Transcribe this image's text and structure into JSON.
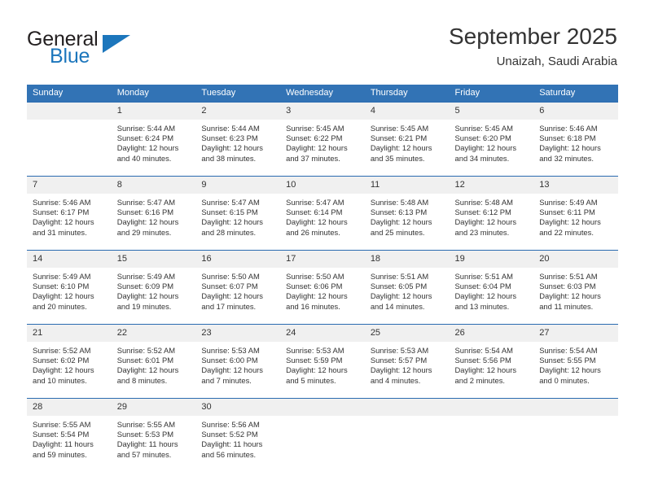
{
  "brand": {
    "word1": "General",
    "word2": "Blue",
    "triangle_icon": "triangle-icon",
    "accent_color": "#1c76bc"
  },
  "header": {
    "title": "September 2025",
    "subtitle": "Unaizah, Saudi Arabia"
  },
  "calendar": {
    "header_bg": "#3273b5",
    "daynum_bg": "#f0f0f0",
    "weekday_headers": [
      "Sunday",
      "Monday",
      "Tuesday",
      "Wednesday",
      "Thursday",
      "Friday",
      "Saturday"
    ],
    "weeks": [
      [
        {
          "day": "",
          "blank": true,
          "sunrise": "",
          "sunset": "",
          "daylight1": "",
          "daylight2": ""
        },
        {
          "day": "1",
          "sunrise": "Sunrise: 5:44 AM",
          "sunset": "Sunset: 6:24 PM",
          "daylight1": "Daylight: 12 hours",
          "daylight2": "and 40 minutes."
        },
        {
          "day": "2",
          "sunrise": "Sunrise: 5:44 AM",
          "sunset": "Sunset: 6:23 PM",
          "daylight1": "Daylight: 12 hours",
          "daylight2": "and 38 minutes."
        },
        {
          "day": "3",
          "sunrise": "Sunrise: 5:45 AM",
          "sunset": "Sunset: 6:22 PM",
          "daylight1": "Daylight: 12 hours",
          "daylight2": "and 37 minutes."
        },
        {
          "day": "4",
          "sunrise": "Sunrise: 5:45 AM",
          "sunset": "Sunset: 6:21 PM",
          "daylight1": "Daylight: 12 hours",
          "daylight2": "and 35 minutes."
        },
        {
          "day": "5",
          "sunrise": "Sunrise: 5:45 AM",
          "sunset": "Sunset: 6:20 PM",
          "daylight1": "Daylight: 12 hours",
          "daylight2": "and 34 minutes."
        },
        {
          "day": "6",
          "sunrise": "Sunrise: 5:46 AM",
          "sunset": "Sunset: 6:18 PM",
          "daylight1": "Daylight: 12 hours",
          "daylight2": "and 32 minutes."
        }
      ],
      [
        {
          "day": "7",
          "sunrise": "Sunrise: 5:46 AM",
          "sunset": "Sunset: 6:17 PM",
          "daylight1": "Daylight: 12 hours",
          "daylight2": "and 31 minutes."
        },
        {
          "day": "8",
          "sunrise": "Sunrise: 5:47 AM",
          "sunset": "Sunset: 6:16 PM",
          "daylight1": "Daylight: 12 hours",
          "daylight2": "and 29 minutes."
        },
        {
          "day": "9",
          "sunrise": "Sunrise: 5:47 AM",
          "sunset": "Sunset: 6:15 PM",
          "daylight1": "Daylight: 12 hours",
          "daylight2": "and 28 minutes."
        },
        {
          "day": "10",
          "sunrise": "Sunrise: 5:47 AM",
          "sunset": "Sunset: 6:14 PM",
          "daylight1": "Daylight: 12 hours",
          "daylight2": "and 26 minutes."
        },
        {
          "day": "11",
          "sunrise": "Sunrise: 5:48 AM",
          "sunset": "Sunset: 6:13 PM",
          "daylight1": "Daylight: 12 hours",
          "daylight2": "and 25 minutes."
        },
        {
          "day": "12",
          "sunrise": "Sunrise: 5:48 AM",
          "sunset": "Sunset: 6:12 PM",
          "daylight1": "Daylight: 12 hours",
          "daylight2": "and 23 minutes."
        },
        {
          "day": "13",
          "sunrise": "Sunrise: 5:49 AM",
          "sunset": "Sunset: 6:11 PM",
          "daylight1": "Daylight: 12 hours",
          "daylight2": "and 22 minutes."
        }
      ],
      [
        {
          "day": "14",
          "sunrise": "Sunrise: 5:49 AM",
          "sunset": "Sunset: 6:10 PM",
          "daylight1": "Daylight: 12 hours",
          "daylight2": "and 20 minutes."
        },
        {
          "day": "15",
          "sunrise": "Sunrise: 5:49 AM",
          "sunset": "Sunset: 6:09 PM",
          "daylight1": "Daylight: 12 hours",
          "daylight2": "and 19 minutes."
        },
        {
          "day": "16",
          "sunrise": "Sunrise: 5:50 AM",
          "sunset": "Sunset: 6:07 PM",
          "daylight1": "Daylight: 12 hours",
          "daylight2": "and 17 minutes."
        },
        {
          "day": "17",
          "sunrise": "Sunrise: 5:50 AM",
          "sunset": "Sunset: 6:06 PM",
          "daylight1": "Daylight: 12 hours",
          "daylight2": "and 16 minutes."
        },
        {
          "day": "18",
          "sunrise": "Sunrise: 5:51 AM",
          "sunset": "Sunset: 6:05 PM",
          "daylight1": "Daylight: 12 hours",
          "daylight2": "and 14 minutes."
        },
        {
          "day": "19",
          "sunrise": "Sunrise: 5:51 AM",
          "sunset": "Sunset: 6:04 PM",
          "daylight1": "Daylight: 12 hours",
          "daylight2": "and 13 minutes."
        },
        {
          "day": "20",
          "sunrise": "Sunrise: 5:51 AM",
          "sunset": "Sunset: 6:03 PM",
          "daylight1": "Daylight: 12 hours",
          "daylight2": "and 11 minutes."
        }
      ],
      [
        {
          "day": "21",
          "sunrise": "Sunrise: 5:52 AM",
          "sunset": "Sunset: 6:02 PM",
          "daylight1": "Daylight: 12 hours",
          "daylight2": "and 10 minutes."
        },
        {
          "day": "22",
          "sunrise": "Sunrise: 5:52 AM",
          "sunset": "Sunset: 6:01 PM",
          "daylight1": "Daylight: 12 hours",
          "daylight2": "and 8 minutes."
        },
        {
          "day": "23",
          "sunrise": "Sunrise: 5:53 AM",
          "sunset": "Sunset: 6:00 PM",
          "daylight1": "Daylight: 12 hours",
          "daylight2": "and 7 minutes."
        },
        {
          "day": "24",
          "sunrise": "Sunrise: 5:53 AM",
          "sunset": "Sunset: 5:59 PM",
          "daylight1": "Daylight: 12 hours",
          "daylight2": "and 5 minutes."
        },
        {
          "day": "25",
          "sunrise": "Sunrise: 5:53 AM",
          "sunset": "Sunset: 5:57 PM",
          "daylight1": "Daylight: 12 hours",
          "daylight2": "and 4 minutes."
        },
        {
          "day": "26",
          "sunrise": "Sunrise: 5:54 AM",
          "sunset": "Sunset: 5:56 PM",
          "daylight1": "Daylight: 12 hours",
          "daylight2": "and 2 minutes."
        },
        {
          "day": "27",
          "sunrise": "Sunrise: 5:54 AM",
          "sunset": "Sunset: 5:55 PM",
          "daylight1": "Daylight: 12 hours",
          "daylight2": "and 0 minutes."
        }
      ],
      [
        {
          "day": "28",
          "sunrise": "Sunrise: 5:55 AM",
          "sunset": "Sunset: 5:54 PM",
          "daylight1": "Daylight: 11 hours",
          "daylight2": "and 59 minutes."
        },
        {
          "day": "29",
          "sunrise": "Sunrise: 5:55 AM",
          "sunset": "Sunset: 5:53 PM",
          "daylight1": "Daylight: 11 hours",
          "daylight2": "and 57 minutes."
        },
        {
          "day": "30",
          "sunrise": "Sunrise: 5:56 AM",
          "sunset": "Sunset: 5:52 PM",
          "daylight1": "Daylight: 11 hours",
          "daylight2": "and 56 minutes."
        },
        {
          "day": "",
          "blank": true,
          "sunrise": "",
          "sunset": "",
          "daylight1": "",
          "daylight2": ""
        },
        {
          "day": "",
          "blank": true,
          "sunrise": "",
          "sunset": "",
          "daylight1": "",
          "daylight2": ""
        },
        {
          "day": "",
          "blank": true,
          "sunrise": "",
          "sunset": "",
          "daylight1": "",
          "daylight2": ""
        },
        {
          "day": "",
          "blank": true,
          "sunrise": "",
          "sunset": "",
          "daylight1": "",
          "daylight2": ""
        }
      ]
    ]
  }
}
